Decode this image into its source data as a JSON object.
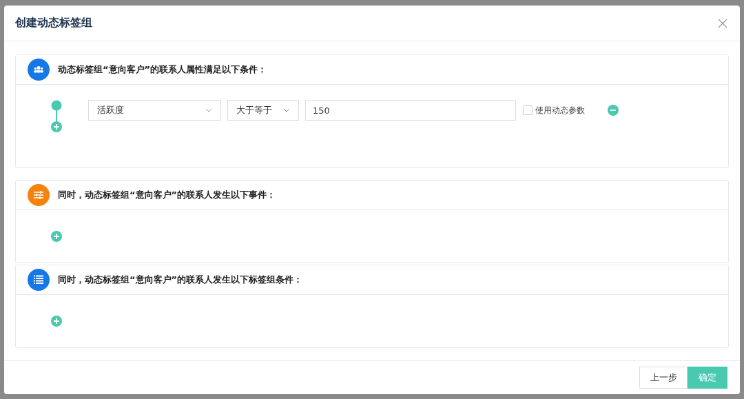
{
  "dialog": {
    "title": "创建动态标签组"
  },
  "sections": [
    {
      "kind": "attributes",
      "title": "动态标签组“意向客户”的联系人属性满足以下条件：",
      "conditions": [
        {
          "attribute": "活跃度",
          "operator": "大于等于",
          "value": "150",
          "dynamic_label": "使用动态参数",
          "checked": false
        }
      ]
    },
    {
      "kind": "events",
      "title": "同时，动态标签组“意向客户”的联系人发生以下事件："
    },
    {
      "kind": "tag_groups",
      "title": "同时，动态标签组“意向客户”的联系人发生以下标签组条件："
    }
  ],
  "buttons": [
    {
      "label": "上一步",
      "kind": "secondary"
    },
    {
      "label": "确定",
      "kind": "primary"
    }
  ]
}
